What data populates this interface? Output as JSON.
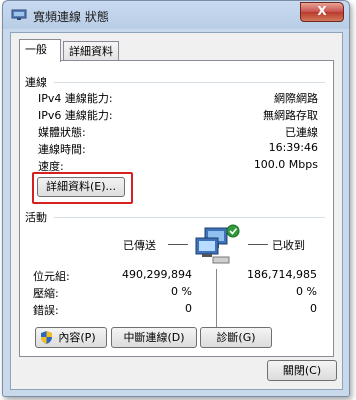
{
  "window": {
    "title": "寬頻連線 狀態",
    "close_label": "X"
  },
  "tabs": [
    {
      "label": "一般"
    },
    {
      "label": "詳細資料"
    }
  ],
  "connection": {
    "heading": "連線",
    "rows": [
      {
        "label": "IPv4 連線能力:",
        "value": "網際網路"
      },
      {
        "label": "IPv6 連線能力:",
        "value": "無網路存取"
      },
      {
        "label": "媒體狀態:",
        "value": "已連線"
      },
      {
        "label": "連線時間:",
        "value": "16:39:46"
      },
      {
        "label": "速度:",
        "value": "100.0 Mbps"
      }
    ],
    "details_button": "詳細資料(E)..."
  },
  "activity": {
    "heading": "活動",
    "sent_label": "已傳送",
    "received_label": "已收到",
    "rows": [
      {
        "label": "位元組:",
        "sent": "490,299,894",
        "received": "186,714,985"
      },
      {
        "label": "壓縮:",
        "sent": "0 %",
        "received": "0 %"
      },
      {
        "label": "錯誤:",
        "sent": "0",
        "received": "0"
      }
    ]
  },
  "buttons": {
    "properties": "內容(P)",
    "disconnect": "中斷連線(D)",
    "diagnose": "診斷(G)",
    "close": "關閉(C)"
  },
  "colors": {
    "highlight": "#d62020",
    "title_gradient": "#c8daf0",
    "close_button": "#c75050"
  },
  "icons": [
    "network-icon",
    "close-icon",
    "connected-computers-icon",
    "shield-icon"
  ]
}
